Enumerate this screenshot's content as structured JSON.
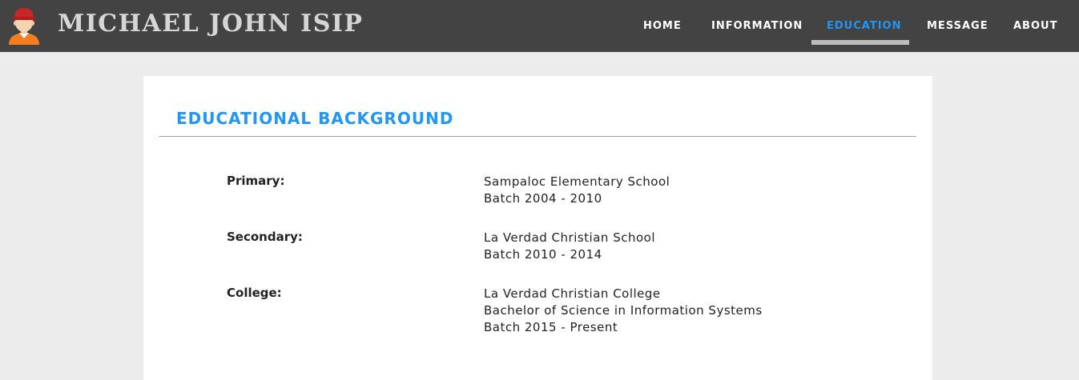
{
  "header": {
    "title": "MICHAEL JOHN ISIP",
    "avatar_icon": "user-avatar-icon",
    "background_color": "#434343"
  },
  "nav": {
    "items": [
      {
        "label": "HOME",
        "active": false
      },
      {
        "label": "INFORMATION",
        "active": false
      },
      {
        "label": "EDUCATION",
        "active": true
      },
      {
        "label": "MESSAGE",
        "active": false
      },
      {
        "label": "ABOUT",
        "active": false
      }
    ],
    "active_color": "#2196f3"
  },
  "main": {
    "section_title": "EDUCATIONAL BACKGROUND",
    "entries": [
      {
        "level": "Primary:",
        "lines": [
          "Sampaloc Elementary School",
          "Batch 2004 - 2010"
        ]
      },
      {
        "level": "Secondary:",
        "lines": [
          "La Verdad Christian School",
          "Batch 2010 - 2014"
        ]
      },
      {
        "level": "College:",
        "lines": [
          "La Verdad Christian College",
          "Bachelor of Science in Information Systems",
          "Batch 2015 - Present"
        ]
      }
    ]
  }
}
